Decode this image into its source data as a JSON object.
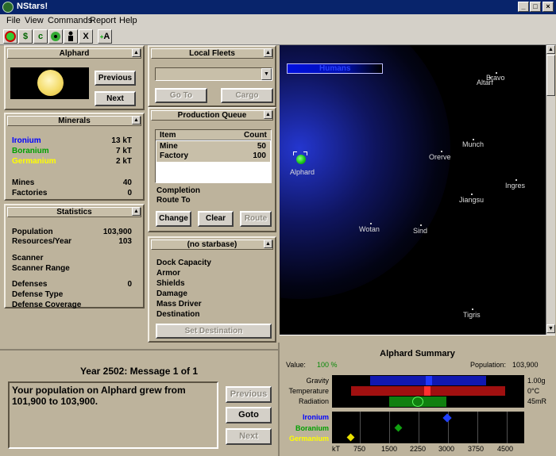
{
  "window": {
    "title": "NStars!"
  },
  "menu": [
    "File",
    "View",
    "Commands",
    "Report",
    "Help"
  ],
  "toolbar": {
    "tools": [
      "planet-tool",
      "surface-tool",
      "concentration-tool",
      "planet-value-tool",
      "population-tool",
      "no-info-tool",
      "add-waypoint-tool"
    ]
  },
  "planet_panel": {
    "title": "Alphard",
    "previous": "Previous",
    "next": "Next"
  },
  "minerals_panel": {
    "title": "Minerals",
    "ironium": {
      "label": "Ironium",
      "value": "13 kT",
      "color": "#0000ff"
    },
    "boranium": {
      "label": "Boranium",
      "value": "7 kT",
      "color": "#00a000"
    },
    "germanium": {
      "label": "Germanium",
      "value": "2 kT",
      "color": "#ffff00"
    },
    "mines": {
      "label": "Mines",
      "value": "40"
    },
    "factories": {
      "label": "Factories",
      "value": "0"
    }
  },
  "statistics_panel": {
    "title": "Statistics",
    "population": {
      "label": "Population",
      "value": "103,900"
    },
    "resources": {
      "label": "Resources/Year",
      "value": "103"
    },
    "scanner": "Scanner",
    "scanner_range": "Scanner Range",
    "defenses": {
      "label": "Defenses",
      "value": "0"
    },
    "defense_type": "Defense Type",
    "defense_coverage": "Defense Coverage"
  },
  "fleets_panel": {
    "title": "Local Fleets",
    "goto": "Go To",
    "cargo": "Cargo"
  },
  "production_panel": {
    "title": "Production Queue",
    "col_item": "Item",
    "col_count": "Count",
    "rows": [
      {
        "item": "Mine",
        "count": "50"
      },
      {
        "item": "Factory",
        "count": "100"
      }
    ],
    "completion": "Completion",
    "route_to": "Route To",
    "change": "Change",
    "clear": "Clear",
    "route": "Route"
  },
  "starbase_panel": {
    "title": "(no starbase)",
    "fields": [
      "Dock Capacity",
      "Armor",
      "Shields",
      "Damage",
      "Mass Driver",
      "Destination"
    ],
    "set_destination": "Set Destination"
  },
  "messages": {
    "header": "Year 2502: Message 1 of 1",
    "text": "Your population on Alphard grew from 101,900 to 103,900.",
    "previous": "Previous",
    "goto": "Goto",
    "next": "Next"
  },
  "map": {
    "player_label": "Humans",
    "stars": [
      {
        "name": "Bravo"
      },
      {
        "name": "Altarf"
      },
      {
        "name": "Munch"
      },
      {
        "name": "Orerve"
      },
      {
        "name": "Alphard"
      },
      {
        "name": "Ingres"
      },
      {
        "name": "Jiangsu"
      },
      {
        "name": "Wotan"
      },
      {
        "name": "Sind"
      },
      {
        "name": "Tigris"
      }
    ]
  },
  "summary": {
    "title": "Alphard Summary",
    "value_label": "Value:",
    "value": "100 %",
    "population_label": "Population:",
    "population": "103,900",
    "gravity": {
      "label": "Gravity",
      "value": "1.00g"
    },
    "temperature": {
      "label": "Temperature",
      "value": "0°C"
    },
    "radiation": {
      "label": "Radiation",
      "value": "45mR"
    },
    "minerals": [
      {
        "label": "Ironium",
        "color": "#0000ff"
      },
      {
        "label": "Boranium",
        "color": "#00a000"
      },
      {
        "label": "Germanium",
        "color": "#ffff00"
      }
    ],
    "axis": [
      "kT",
      "750",
      "1500",
      "2250",
      "3000",
      "3750",
      "4500"
    ]
  }
}
